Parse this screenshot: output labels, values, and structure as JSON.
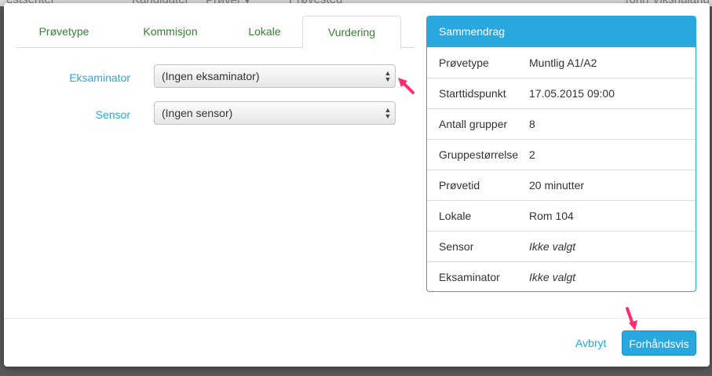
{
  "background_nav": [
    "estsenter",
    "Kandidater",
    "Prøver ▾",
    "Prøvested",
    "Tonn Viksnaland"
  ],
  "tabs": [
    {
      "label": "Prøvetype",
      "active": false
    },
    {
      "label": "Kommisjon",
      "active": false
    },
    {
      "label": "Lokale",
      "active": false
    },
    {
      "label": "Vurdering",
      "active": true
    }
  ],
  "form": {
    "examiner_label": "Eksaminator",
    "examiner_value": "(Ingen eksaminator)",
    "sensor_label": "Sensor",
    "sensor_value": "(Ingen sensor)"
  },
  "summary": {
    "title": "Sammendrag",
    "rows": [
      {
        "key": "Prøvetype",
        "value": "Muntlig A1/A2"
      },
      {
        "key": "Starttidspunkt",
        "value": "17.05.2015 09:00"
      },
      {
        "key": "Antall grupper",
        "value": "8"
      },
      {
        "key": "Gruppestørrelse",
        "value": "2"
      },
      {
        "key": "Prøvetid",
        "value": "20 minutter"
      },
      {
        "key": "Lokale",
        "value": "Rom 104"
      },
      {
        "key": "Sensor",
        "value": "Ikke valgt"
      },
      {
        "key": "Eksaminator",
        "value": "Ikke valgt"
      }
    ]
  },
  "footer": {
    "cancel_label": "Avbryt",
    "preview_label": "Forhåndsvis"
  },
  "colors": {
    "accent": "#29a8e0",
    "tab_text": "#3c7d39",
    "annotation_arrow": "#ff2d6f"
  }
}
